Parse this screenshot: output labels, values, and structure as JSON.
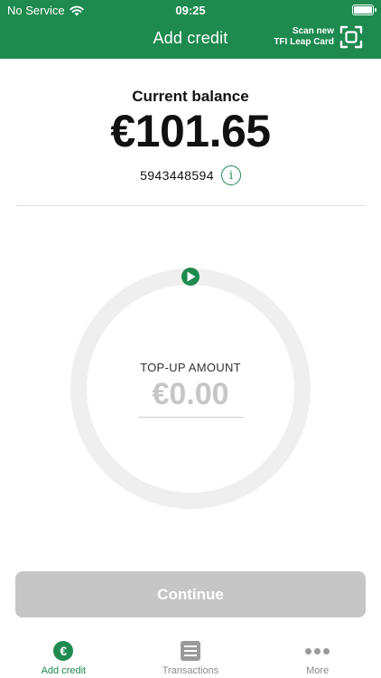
{
  "status_bar": {
    "carrier": "No Service",
    "time": "09:25"
  },
  "header": {
    "title": "Add credit",
    "scan_line1": "Scan new",
    "scan_line2": "TFI Leap Card"
  },
  "balance": {
    "label": "Current balance",
    "value": "€101.65",
    "card_number": "5943448594",
    "info_glyph": "i"
  },
  "topup": {
    "label": "TOP-UP AMOUNT",
    "value": "€0.00",
    "dial_level": 0
  },
  "continue_label": "Continue",
  "tabs": [
    {
      "label": "Add credit",
      "icon": "euro-icon",
      "active": true
    },
    {
      "label": "Transactions",
      "icon": "list-icon",
      "active": false
    },
    {
      "label": "More",
      "icon": "more-icon",
      "active": false
    }
  ],
  "colors": {
    "brand_green": "#1e8a4f",
    "disabled_gray": "#c6c6c6",
    "dial_track": "#f0efef"
  }
}
